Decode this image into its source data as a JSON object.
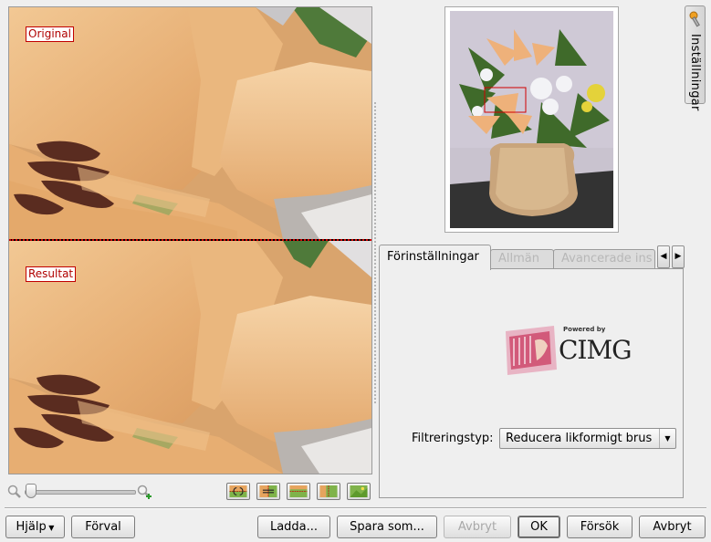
{
  "preview": {
    "original_label": "Original",
    "result_label": "Resultat"
  },
  "zoom": {
    "zoom_out_icon": "zoom-out-icon",
    "zoom_in_icon": "zoom-in-icon",
    "level": 0.0
  },
  "preview_modes": [
    "split-horizontal",
    "split-vertical",
    "duplicate-horizontal",
    "duplicate-vertical",
    "before-after"
  ],
  "settings_tab": {
    "label": "Inställningar",
    "icon": "wrench-icon"
  },
  "notebook": {
    "tabs": [
      {
        "label": "Förinställningar",
        "active": true
      },
      {
        "label": "Allmän",
        "active": false
      },
      {
        "label": "Avancerade ins",
        "active": false
      }
    ],
    "logo": {
      "powered_by": "Powered by",
      "name": "CIMG"
    },
    "filter_label": "Filtreringstyp:",
    "filter_value": "Reducera likformigt brus"
  },
  "buttons": {
    "help": "Hjälp",
    "defaults": "Förval",
    "load": "Ladda...",
    "save_as": "Spara som...",
    "abort": "Avbryt",
    "ok": "OK",
    "retry": "Försök",
    "cancel": "Avbryt"
  },
  "colors": {
    "petal": "#e9b57c",
    "petal_light": "#f3cfa0",
    "label_red": "#c00000"
  }
}
